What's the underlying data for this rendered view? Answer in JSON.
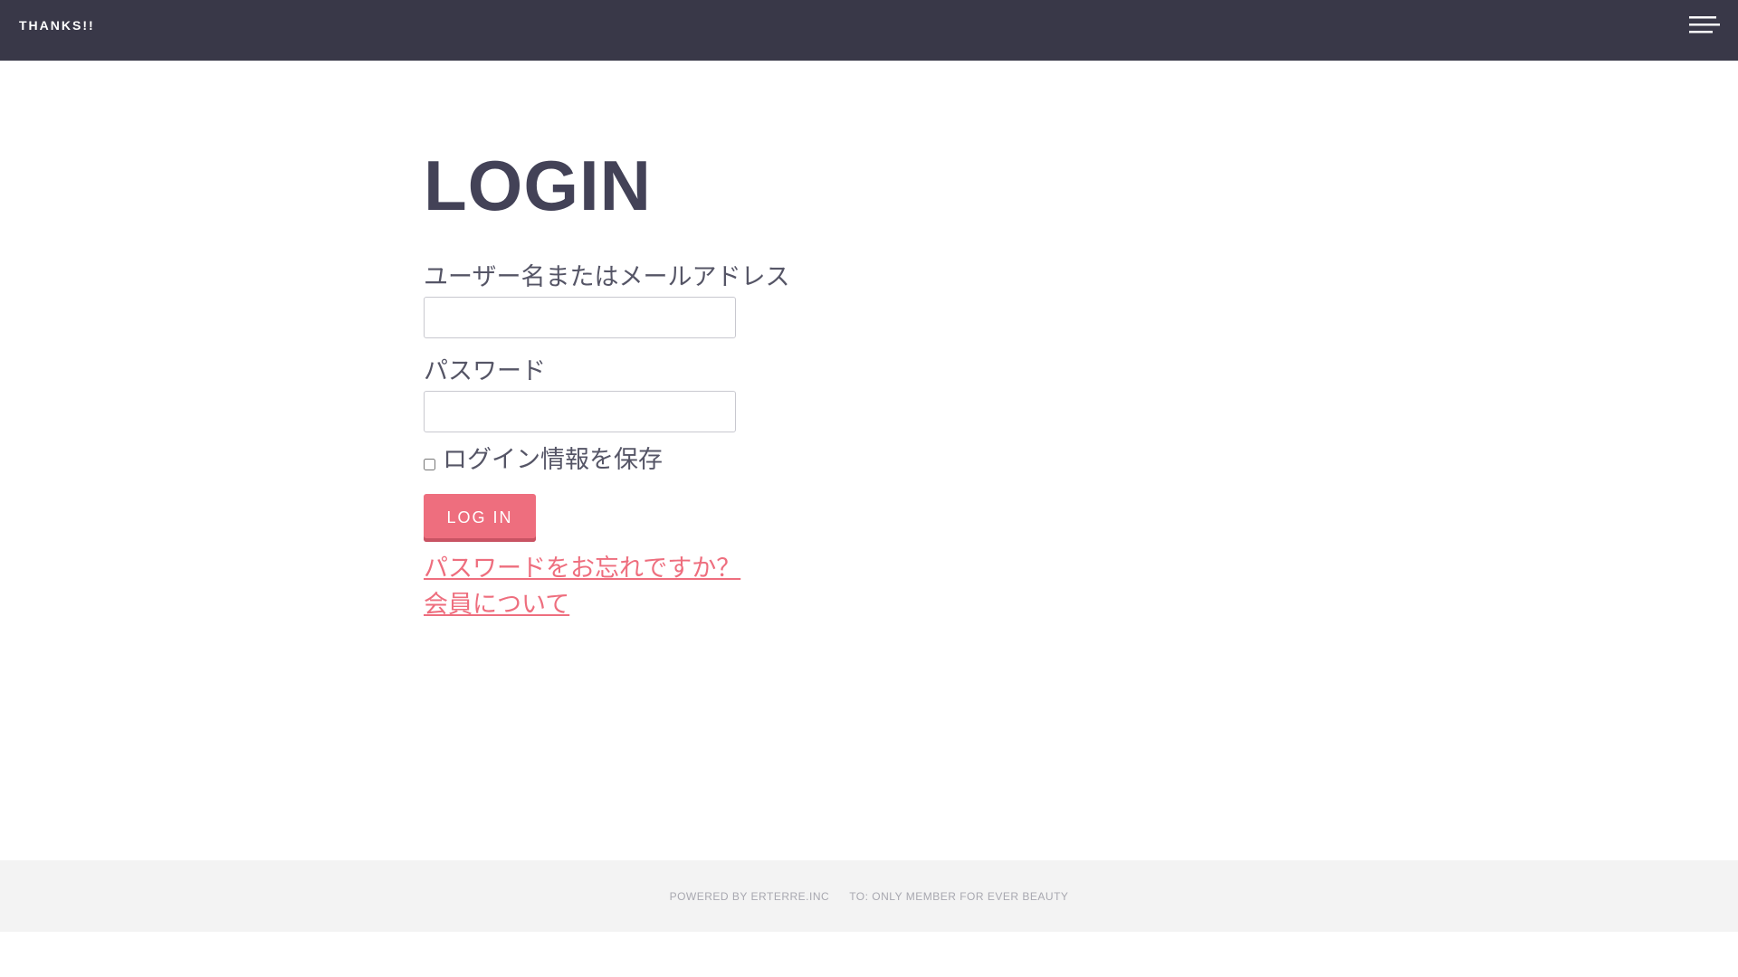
{
  "header": {
    "site_title": "THANKS!!",
    "menu_icon": "hamburger-icon",
    "background_color": "#393848"
  },
  "login": {
    "title": "LOGIN",
    "username_label": "ユーザー名またはメールアドレス",
    "username_value": "",
    "password_label": "パスワード",
    "password_value": "",
    "remember_label": "ログイン情報を保存",
    "remember_checked": false,
    "submit_label": "LOG IN",
    "accent_color": "#ee6e7e"
  },
  "links": {
    "forgot_password": "パスワードをお忘れですか？",
    "about_membership": "会員について"
  },
  "footer": {
    "powered_by": "POWERED BY ERTERRE.INC",
    "tagline": "TO: ONLY MEMBER FOR EVER BEAUTY"
  }
}
